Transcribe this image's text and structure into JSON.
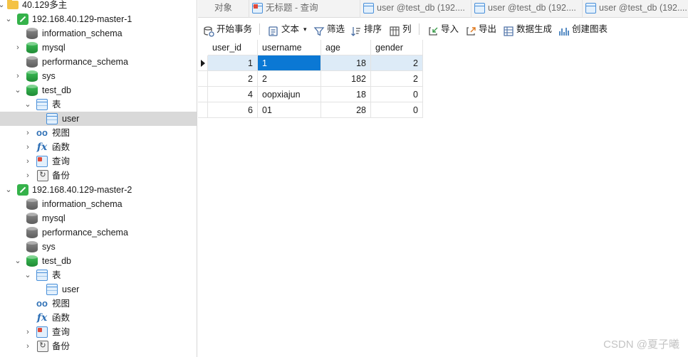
{
  "nav": {
    "group": "40.129多主",
    "connections": [
      {
        "name": "192.168.40.129-master-1",
        "dbs": [
          "information_schema",
          "mysql",
          "performance_schema",
          "sys"
        ],
        "open_db": "test_db",
        "objects": {
          "tables": "表",
          "table_item": "user",
          "views": "视图",
          "functions": "函数",
          "queries": "查询",
          "backups": "备份"
        }
      },
      {
        "name": "192.168.40.129-master-2",
        "dbs": [
          "information_schema",
          "mysql",
          "performance_schema",
          "sys"
        ],
        "open_db": "test_db",
        "objects": {
          "tables": "表",
          "table_item": "user",
          "views": "视图",
          "functions": "函数",
          "queries": "查询",
          "backups": "备份"
        }
      }
    ]
  },
  "tabs": [
    {
      "label": "对象"
    },
    {
      "label": "无标题 - 查询"
    },
    {
      "label": "user @test_db (192...."
    },
    {
      "label": "user @test_db (192...."
    },
    {
      "label": "user @test_db (192...."
    }
  ],
  "toolbar": {
    "begin_tx": "开始事务",
    "text": "文本",
    "filter": "筛选",
    "sort": "排序",
    "columns": "列",
    "import": "导入",
    "export": "导出",
    "data_gen": "数据生成",
    "create_chart": "创建图表"
  },
  "grid": {
    "columns": [
      "user_id",
      "username",
      "age",
      "gender"
    ],
    "rows": [
      [
        "1",
        "1",
        "18",
        "2"
      ],
      [
        "2",
        "2",
        "182",
        "2"
      ],
      [
        "4",
        "oopxiajun",
        "18",
        "0"
      ],
      [
        "6",
        "01",
        "28",
        "0"
      ]
    ]
  },
  "watermark": "CSDN @夏子曦",
  "colors": {
    "selection": "#0b78d4",
    "row_highlight": "#ddebf7",
    "tree_selected": "#d9d9d9"
  }
}
